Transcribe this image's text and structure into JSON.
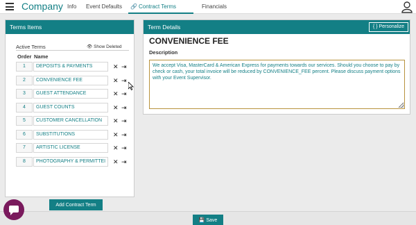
{
  "nav": {
    "brand": "Company",
    "links": [
      {
        "label": "Info"
      },
      {
        "label": "Event Defaults"
      },
      {
        "label": "Contract Terms",
        "icon": "link-icon",
        "active": true
      },
      {
        "label": "Financials"
      }
    ]
  },
  "left_panel": {
    "title": "Terms Items",
    "active_terms_label": "Active Terms",
    "show_deleted_label": "Show Deleted",
    "col_order": "Order",
    "col_name": "Name",
    "terms": [
      {
        "order": "1",
        "name": "DEPOSITS & PAYMENTS"
      },
      {
        "order": "2",
        "name": "CONVENIENCE FEE"
      },
      {
        "order": "3",
        "name": "GUEST ATTENDANCE"
      },
      {
        "order": "4",
        "name": "GUEST COUNTS"
      },
      {
        "order": "5",
        "name": "CUSTOMER CANCELLATION"
      },
      {
        "order": "6",
        "name": "SUBSTITUTIONS"
      },
      {
        "order": "7",
        "name": "ARTISTIC LICENSE"
      },
      {
        "order": "8",
        "name": "PHOTOGRAPHY & PERMITTEI"
      }
    ],
    "add_button": "Add Contract Term"
  },
  "right_panel": {
    "title": "Term Details",
    "personalize_button": "Personalize",
    "term_title": "CONVENIENCE FEE",
    "description_label": "Description",
    "description": "We accept Visa, MasterCard & American Express for payments towards our services. Should you choose to pay by check or cash, your total invoice will be reduced by CONVENIENCE_FEE percent. Please discuss payment options with your Event Supervisor."
  },
  "footer": {
    "save_button": "Save"
  },
  "colors": {
    "accent": "#137f85",
    "chat": "#7a1a5d",
    "textarea_border": "#b8923d"
  }
}
